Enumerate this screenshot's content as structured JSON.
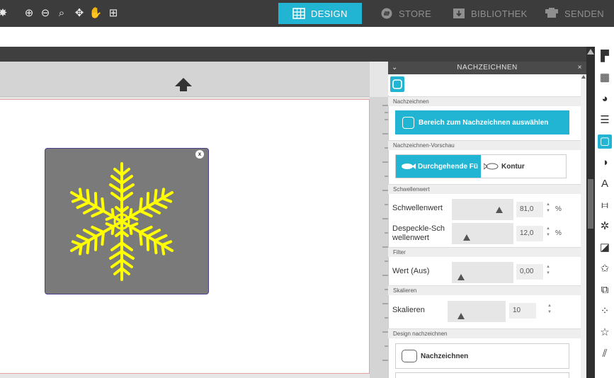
{
  "toolbar": {
    "icons": [
      "target-icon",
      "zoom-in-icon",
      "zoom-out-icon",
      "zoom-drag-icon",
      "move-icon",
      "pan-hand-icon",
      "fit-page-icon"
    ],
    "glyphs": [
      "✸",
      "⊕",
      "⊖",
      "⌕",
      "✥",
      "✋",
      "⊞"
    ]
  },
  "tabs": [
    {
      "label": "DESIGN",
      "active": true,
      "icon": "grid-icon"
    },
    {
      "label": "STORE",
      "active": false,
      "icon": "store-icon"
    },
    {
      "label": "BIBLIOTHEK",
      "active": false,
      "icon": "library-icon"
    },
    {
      "label": "SENDEN",
      "active": false,
      "icon": "send-icon"
    }
  ],
  "colors": {
    "accent": "#22b5d3",
    "toolbar_bg": "#3c3c3c",
    "image_bg": "#7a7a7a",
    "snowflake": "#ffff00",
    "selection_border": "#4a3f8c"
  },
  "panel": {
    "title": "NACHZEICHNEN",
    "sections": {
      "nachzeichnen": "Nachzeichnen",
      "vorschau": "Nachzeichnen-Vorschau",
      "schwellenwert": "Schwellenwert",
      "filter": "Filter",
      "skalieren": "Skalieren",
      "design": "Design nachzeichnen"
    },
    "select_area_button": "Bereich zum Nachzeichnen auswählen",
    "preview_solid": "Durchgehende Fü",
    "preview_contour": "Kontur",
    "threshold": {
      "label": "Schwellenwert",
      "value": "81,0",
      "unit": "%",
      "level": 81
    },
    "despeckle": {
      "label": "Despeckle-Sch wellenwert",
      "value": "12,0",
      "unit": "%",
      "level": 12
    },
    "filter": {
      "label": "Wert (Aus)",
      "value": "0,00",
      "level": 0
    },
    "scale": {
      "label": "Skalieren",
      "value": "10",
      "level": 10
    },
    "trace_button": "Nachzeichnen"
  },
  "right_icons": [
    {
      "name": "page-setup-icon",
      "glyph": "▛",
      "active": false
    },
    {
      "name": "pix-icon",
      "glyph": "▦",
      "active": false
    },
    {
      "name": "fill-palette-icon",
      "glyph": "◕",
      "active": false
    },
    {
      "name": "line-style-icon",
      "glyph": "☰",
      "active": false
    },
    {
      "name": "trace-icon",
      "glyph": "▢",
      "active": true
    },
    {
      "name": "transparency-icon",
      "glyph": "◑",
      "active": false
    },
    {
      "name": "text-style-icon",
      "glyph": "A",
      "active": false
    },
    {
      "name": "align-icon",
      "glyph": "⧦",
      "active": false
    },
    {
      "name": "replicate-icon",
      "glyph": "✲",
      "active": false
    },
    {
      "name": "modify-icon",
      "glyph": "◪",
      "active": false
    },
    {
      "name": "offset-icon",
      "glyph": "✩",
      "active": false
    },
    {
      "name": "library-save-icon",
      "glyph": "⧉",
      "active": false
    },
    {
      "name": "rhinestone-icon",
      "glyph": "⁘",
      "active": false
    },
    {
      "name": "sketch-icon",
      "glyph": "☆",
      "active": false
    },
    {
      "name": "knife-icon",
      "glyph": "⫽",
      "active": false
    }
  ]
}
